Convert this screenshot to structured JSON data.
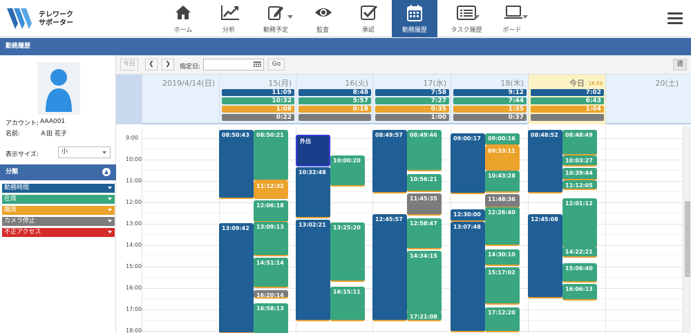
{
  "app": {
    "logo_line1": "テレワーク",
    "logo_line2": "サポーター"
  },
  "nav": [
    {
      "label": "ホーム",
      "icon": "home-icon"
    },
    {
      "label": "分析",
      "icon": "chart-icon"
    },
    {
      "label": "勤務予定",
      "icon": "edit-icon"
    },
    {
      "label": "監査",
      "icon": "eye-icon"
    },
    {
      "label": "承認",
      "icon": "checkbox-icon"
    },
    {
      "label": "勤務履歴",
      "icon": "calendar-icon",
      "active": true
    },
    {
      "label": "タスク履歴",
      "icon": "list-icon"
    },
    {
      "label": "ボード",
      "icon": "laptop-icon"
    }
  ],
  "page_title": "勤務履歴",
  "profile": {
    "account_label": "アカウント:",
    "account": "AAA001",
    "name_label": "名前:",
    "name": "Ａ田 花子",
    "size_label": "表示サイズ:",
    "size_value": "小"
  },
  "categories": {
    "title": "分類",
    "items": [
      {
        "label": "勤務時間",
        "color": "#1f5f95"
      },
      {
        "label": "在席",
        "color": "#3aa680"
      },
      {
        "label": "離席",
        "color": "#eba32b"
      },
      {
        "label": "カメラ停止",
        "color": "#7c7c7c"
      },
      {
        "label": "不正アクセス",
        "color": "#d62b2b"
      }
    ]
  },
  "toolbar": {
    "today": "今日",
    "prev": "❮",
    "next": "❯",
    "date_label": "指定日:",
    "go": "Go",
    "week": "週"
  },
  "days": [
    {
      "label": "2019/4/14(日)",
      "sums": []
    },
    {
      "label": "15(月)",
      "sums": [
        "11:09",
        "10:32",
        "1:08",
        "0:22"
      ]
    },
    {
      "label": "16(火)",
      "sums": [
        "8:48",
        "5:57",
        "0:18",
        ""
      ]
    },
    {
      "label": "17(水)",
      "sums": [
        "7:58",
        "7:27",
        "0:35",
        "1:00"
      ]
    },
    {
      "label": "18(木)",
      "sums": [
        "9:12",
        "7:44",
        "1:35",
        "0:37"
      ]
    },
    {
      "label": "今日",
      "time": "16:53",
      "sums": [
        "7:02",
        "6:43",
        "1:04",
        ""
      ],
      "today": true
    },
    {
      "label": "20(土)",
      "sums": []
    }
  ],
  "hours": [
    "9:00",
    "10:00",
    "11:00",
    "12:00",
    "13:00",
    "14:00",
    "15:00",
    "16:00",
    "17:00",
    "18:00"
  ],
  "blocks": {
    "d1": [
      "08:50:43",
      "13:09:42"
    ],
    "d1s": [
      "08:50:21",
      "11:12:32",
      "12:06:18",
      "13:09:13",
      "14:51:14",
      "16:20:14",
      "16:58:13"
    ],
    "d2": [
      "外出",
      "10:32:48",
      "13:02:21"
    ],
    "d2s": [
      "10:00:20",
      "13:25:20",
      "16:15:11"
    ],
    "d3": [
      "08:49:57",
      "12:45:57"
    ],
    "d3s": [
      "08:49:46",
      "10:56:21",
      "11:45:35",
      "12:58:47",
      "14:34:15",
      "17:21:08"
    ],
    "d4": [
      "09:00:17",
      "12:30:00",
      "13:07:48"
    ],
    "d4s": [
      "09:00:16",
      "09:33:11",
      "10:43:28",
      "11:48:36",
      "12:26:40",
      "14:30:10",
      "15:17:02",
      "17:12:20"
    ],
    "d5": [
      "08:48:52",
      "12:45:08"
    ],
    "d5s": [
      "08:48:49",
      "10:03:27",
      "10:39:44",
      "11:12:05",
      "12:01:12",
      "14:22:21",
      "15:06:40",
      "16:06:13"
    ]
  }
}
